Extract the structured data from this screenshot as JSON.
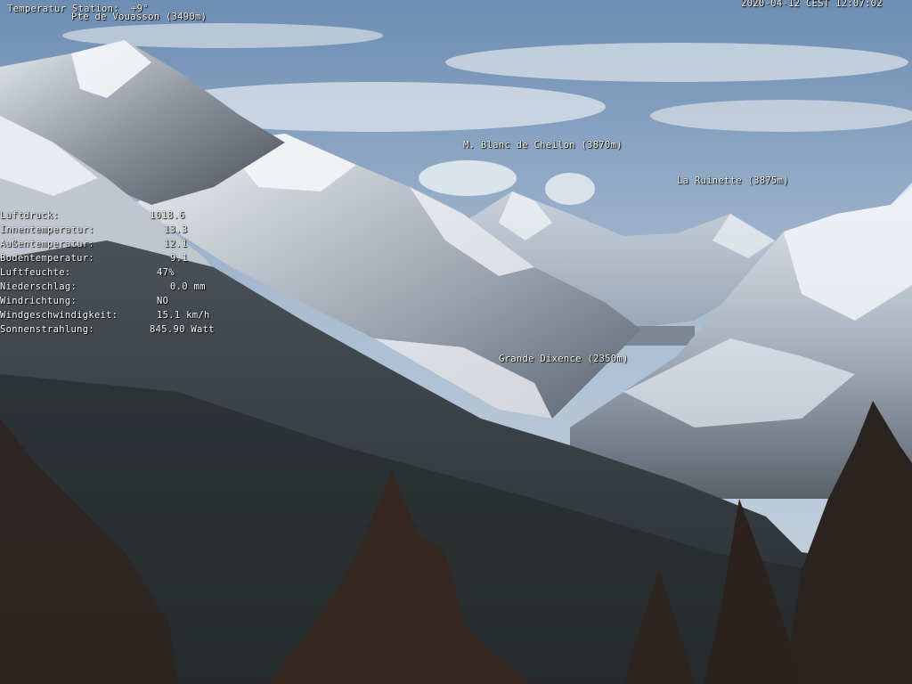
{
  "overlay": {
    "station_temp": "Temperatur Station:  +9°",
    "timestamp": "2020-04-12 CEST 12:07:02"
  },
  "peaks": {
    "vouasson": "Pte de Vouasson (3490m)",
    "cheilon": "M. Blanc de Cheilon (3870m)",
    "ruinette": "La Ruinette (3875m)",
    "dixence": "Grande Dixence (2350m)"
  },
  "weather": [
    {
      "label": "Luftdruck:",
      "value": "1018.6"
    },
    {
      "label": "Innentemperatur:",
      "value": "13.3"
    },
    {
      "label": "Außentemperatur:",
      "value": "12.1"
    },
    {
      "label": "Bodentemperatur:",
      "value": "9.1"
    },
    {
      "label": "Luftfeuchte:",
      "value": "47%"
    },
    {
      "label": "Niederschlag:",
      "value": "0.0 mm"
    },
    {
      "label": "Windrichtung:",
      "value": "NO"
    },
    {
      "label": "Windgeschwindigkeit:",
      "value": "15.1 km/h"
    },
    {
      "label": "Sonnenstrahlung:",
      "value": "845.90 Watt"
    }
  ],
  "colors": {
    "sky_top": "#6e8fb3",
    "sky_bottom": "#c6d3e0",
    "snow": "#eef1f5",
    "rock": "#5c6470",
    "forest": "#2c3236",
    "tree": "#3a2a20"
  }
}
